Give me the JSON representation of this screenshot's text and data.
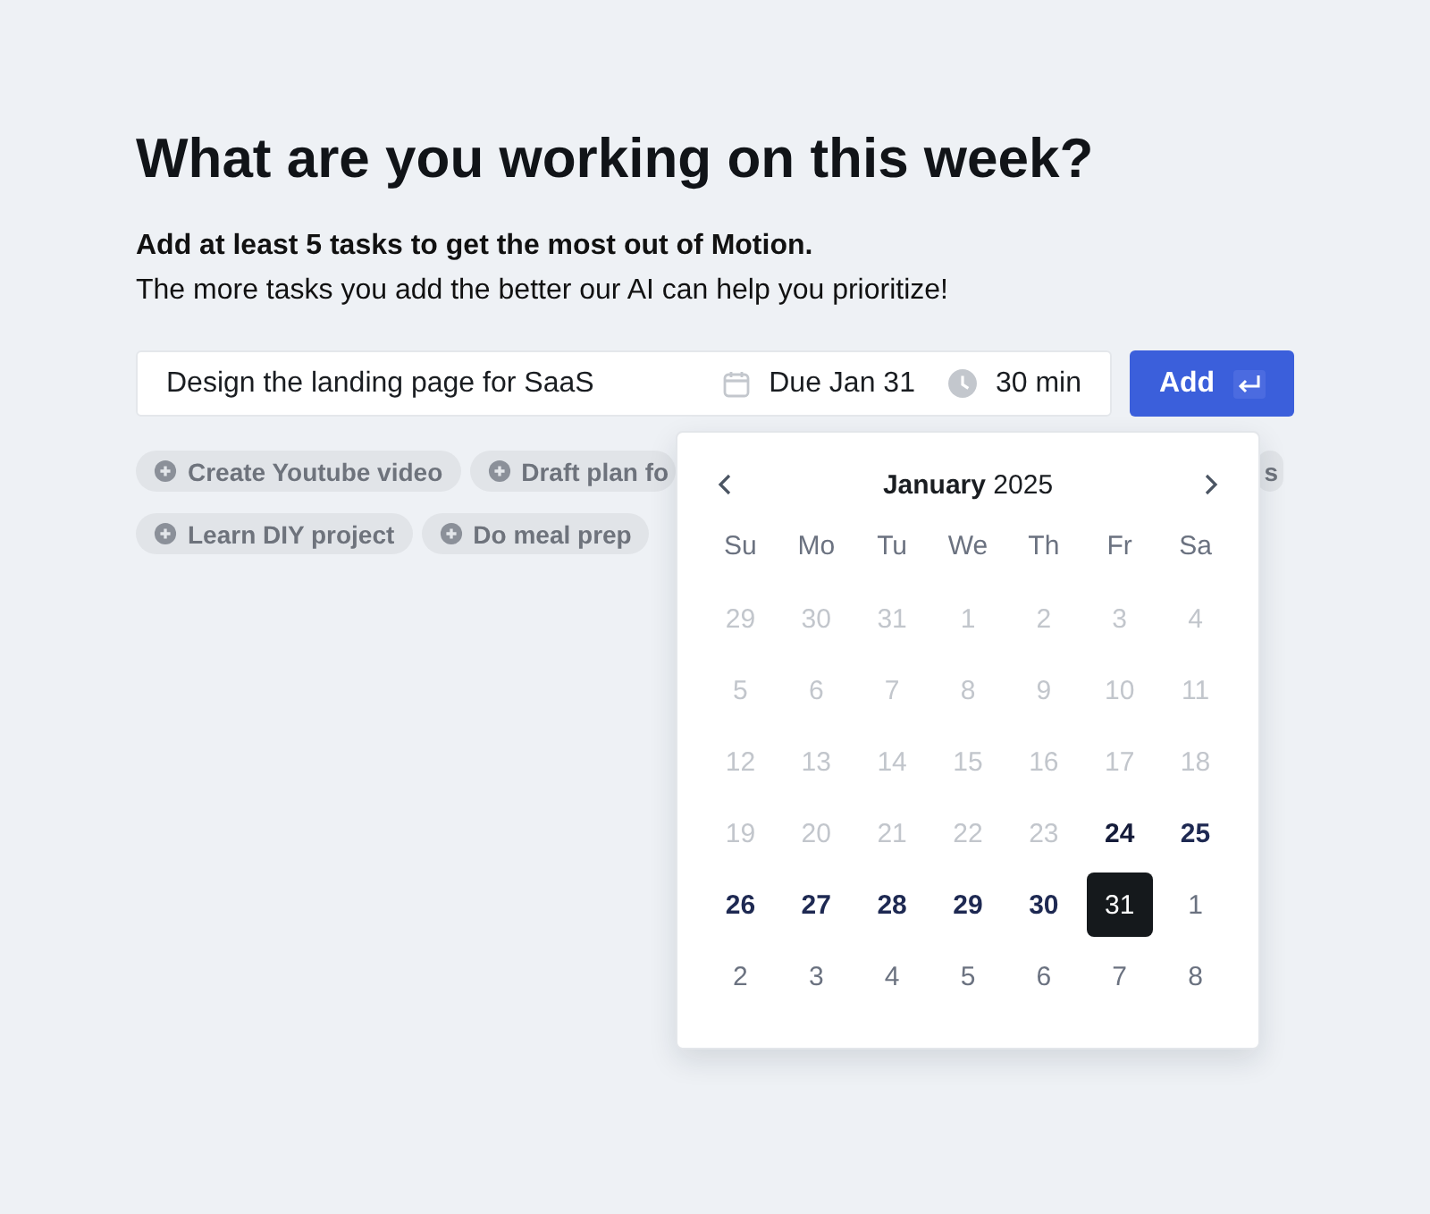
{
  "heading": "What are you working on this week?",
  "subheading": "Add at least 5 tasks to get the most out of Motion.",
  "description": "The more tasks you add the better our AI can help you prioritize!",
  "task_input": {
    "value": "Design the landing page for SaaS",
    "due": "Due Jan 31",
    "duration": "30 min"
  },
  "add_button": {
    "label": "Add"
  },
  "suggestions": [
    {
      "label": "Create Youtube video"
    },
    {
      "label": "Draft plan fo"
    },
    {
      "label": "s"
    },
    {
      "label": "Learn DIY project"
    },
    {
      "label": "Do meal prep"
    }
  ],
  "calendar": {
    "month": "January",
    "year": "2025",
    "weekdays": [
      "Su",
      "Mo",
      "Tu",
      "We",
      "Th",
      "Fr",
      "Sa"
    ],
    "weeks": [
      [
        {
          "day": "29",
          "kind": "past",
          "selected": false
        },
        {
          "day": "30",
          "kind": "past",
          "selected": false
        },
        {
          "day": "31",
          "kind": "past",
          "selected": false
        },
        {
          "day": "1",
          "kind": "past",
          "selected": false
        },
        {
          "day": "2",
          "kind": "past",
          "selected": false
        },
        {
          "day": "3",
          "kind": "past",
          "selected": false
        },
        {
          "day": "4",
          "kind": "past",
          "selected": false
        }
      ],
      [
        {
          "day": "5",
          "kind": "past",
          "selected": false
        },
        {
          "day": "6",
          "kind": "past",
          "selected": false
        },
        {
          "day": "7",
          "kind": "past",
          "selected": false
        },
        {
          "day": "8",
          "kind": "past",
          "selected": false
        },
        {
          "day": "9",
          "kind": "past",
          "selected": false
        },
        {
          "day": "10",
          "kind": "past",
          "selected": false
        },
        {
          "day": "11",
          "kind": "past",
          "selected": false
        }
      ],
      [
        {
          "day": "12",
          "kind": "past",
          "selected": false
        },
        {
          "day": "13",
          "kind": "past",
          "selected": false
        },
        {
          "day": "14",
          "kind": "past",
          "selected": false
        },
        {
          "day": "15",
          "kind": "past",
          "selected": false
        },
        {
          "day": "16",
          "kind": "past",
          "selected": false
        },
        {
          "day": "17",
          "kind": "past",
          "selected": false
        },
        {
          "day": "18",
          "kind": "past",
          "selected": false
        }
      ],
      [
        {
          "day": "19",
          "kind": "past",
          "selected": false
        },
        {
          "day": "20",
          "kind": "past",
          "selected": false
        },
        {
          "day": "21",
          "kind": "past",
          "selected": false
        },
        {
          "day": "22",
          "kind": "past",
          "selected": false
        },
        {
          "day": "23",
          "kind": "past",
          "selected": false
        },
        {
          "day": "24",
          "kind": "today",
          "selected": false
        },
        {
          "day": "25",
          "kind": "current",
          "selected": false
        }
      ],
      [
        {
          "day": "26",
          "kind": "current",
          "selected": false
        },
        {
          "day": "27",
          "kind": "current",
          "selected": false
        },
        {
          "day": "28",
          "kind": "current",
          "selected": false
        },
        {
          "day": "29",
          "kind": "current",
          "selected": false
        },
        {
          "day": "30",
          "kind": "current",
          "selected": false
        },
        {
          "day": "31",
          "kind": "current",
          "selected": true
        },
        {
          "day": "1",
          "kind": "outside",
          "selected": false
        }
      ],
      [
        {
          "day": "2",
          "kind": "outside",
          "selected": false
        },
        {
          "day": "3",
          "kind": "outside",
          "selected": false
        },
        {
          "day": "4",
          "kind": "outside",
          "selected": false
        },
        {
          "day": "5",
          "kind": "outside",
          "selected": false
        },
        {
          "day": "6",
          "kind": "outside",
          "selected": false
        },
        {
          "day": "7",
          "kind": "outside",
          "selected": false
        },
        {
          "day": "8",
          "kind": "outside",
          "selected": false
        }
      ]
    ]
  }
}
